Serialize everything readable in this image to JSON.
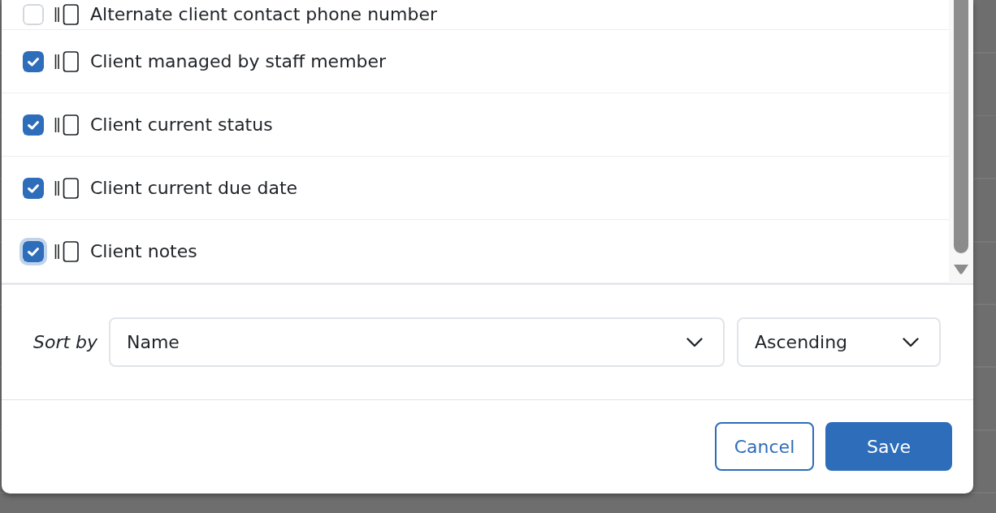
{
  "column_list": {
    "items": [
      {
        "label": "Alternate client contact phone number",
        "checked": false,
        "focused": false
      },
      {
        "label": "Client managed by staff member",
        "checked": true,
        "focused": false
      },
      {
        "label": "Client current status",
        "checked": true,
        "focused": false
      },
      {
        "label": "Client current due date",
        "checked": true,
        "focused": false
      },
      {
        "label": "Client notes",
        "checked": true,
        "focused": true
      }
    ]
  },
  "sort": {
    "label": "Sort by",
    "field": "Name",
    "direction": "Ascending"
  },
  "buttons": [
    {
      "label": "Cancel",
      "kind": "outline"
    },
    {
      "label": "Save",
      "kind": "primary"
    }
  ]
}
